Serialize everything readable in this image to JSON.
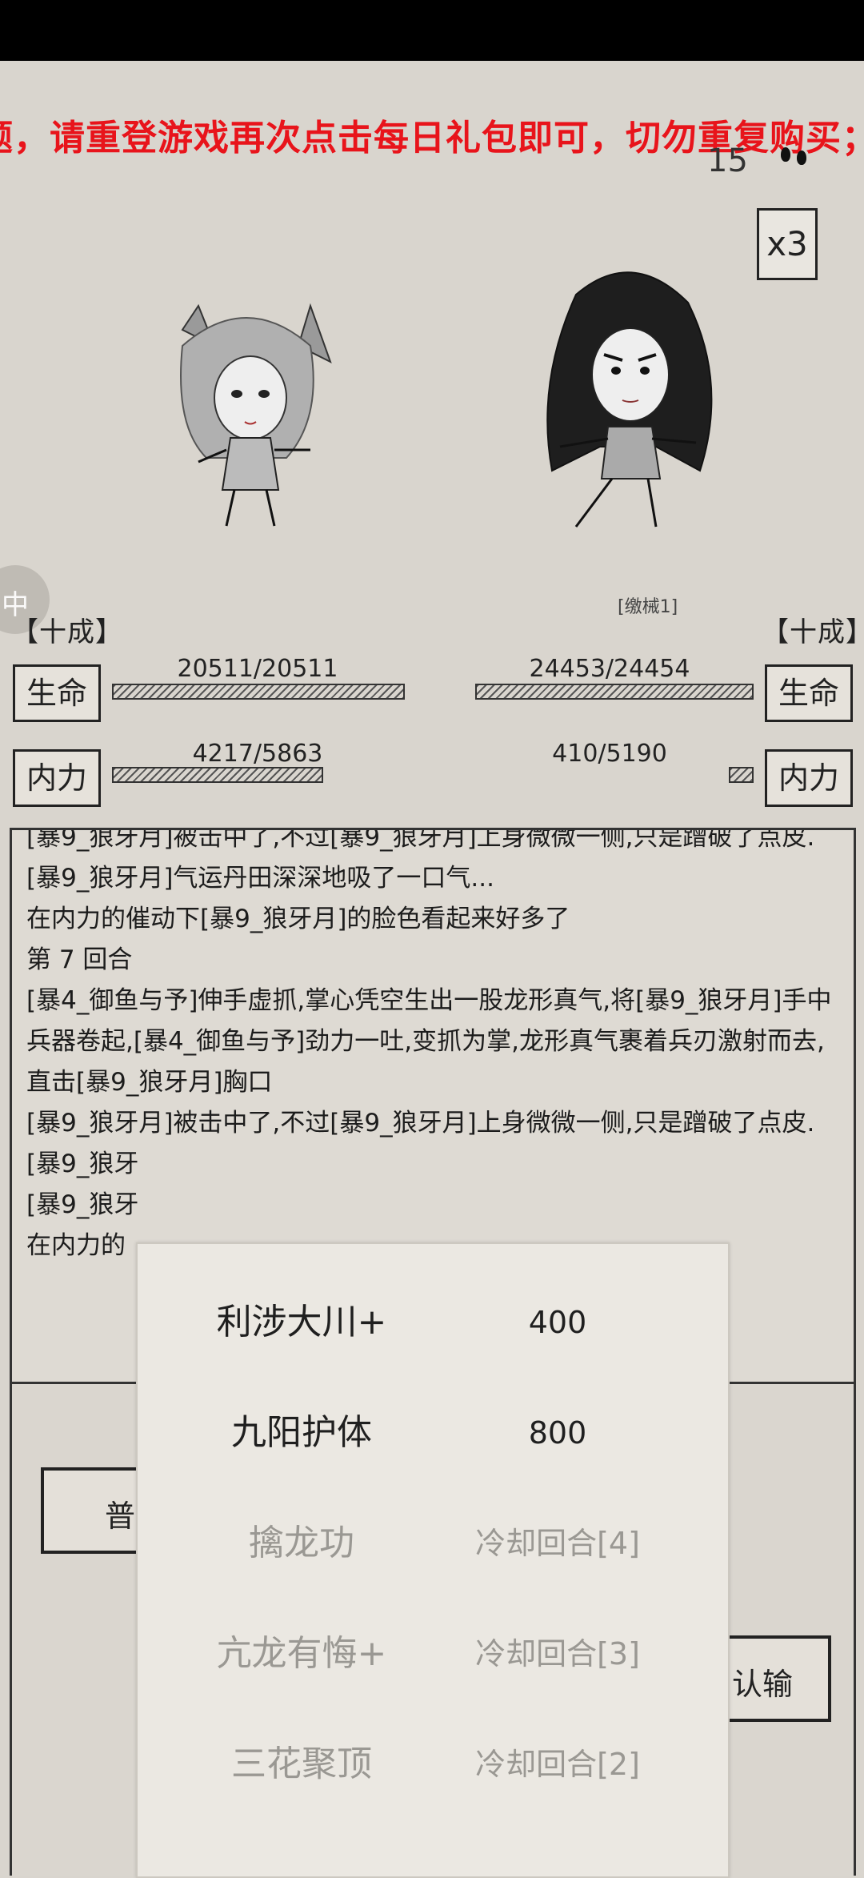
{
  "marquee_text": "题，请重登游戏再次点击每日礼包即可，切勿重复购买；",
  "turn_number": "15",
  "speed_button": "x3",
  "side_button_glyph": "中",
  "player": {
    "rank": "【十成】",
    "hp_label": "生命",
    "hp_text": "20511/20511",
    "hp_fraction": 1.0,
    "mp_label": "内力",
    "mp_text": "4217/5863",
    "mp_fraction": 0.719
  },
  "enemy": {
    "weapon_tag": "[缴械1]",
    "rank": "【十成】",
    "hp_label": "生命",
    "hp_text": "24453/24454",
    "hp_fraction": 1.0,
    "mp_label": "内力",
    "mp_text": "410/5190",
    "mp_fraction": 0.079
  },
  "battle_log": [
    "[暴9_狼牙月]被击中了,不过[暴9_狼牙月]上身微微一侧,只是蹭破了点皮.",
    "[暴9_狼牙月]气运丹田深深地吸了一口气...",
    "在内力的催动下[暴9_狼牙月]的脸色看起来好多了",
    "第 7 回合",
    "[暴4_御鱼与予]伸手虚抓,掌心凭空生出一股龙形真气,将[暴9_狼牙月]手中兵器卷起,[暴4_御鱼与予]劲力一吐,变抓为掌,龙形真气裹着兵刃激射而去,直击[暴9_狼牙月]胸口",
    "[暴9_狼牙月]被击中了,不过[暴9_狼牙月]上身微微一侧,只是蹭破了点皮.",
    "[暴9_狼牙",
    "[暴9_狼牙",
    "在内力的"
  ],
  "bottom_buttons": {
    "attack_partial": "普攻",
    "surrender_partial": "认输"
  },
  "skills": [
    {
      "name": "利涉大川+",
      "value": "400",
      "state": "enabled"
    },
    {
      "name": "九阳护体",
      "value": "800",
      "state": "enabled"
    },
    {
      "name": "擒龙功",
      "value": "冷却回合[4]",
      "state": "disabled"
    },
    {
      "name": "亢龙有悔+",
      "value": "冷却回合[3]",
      "state": "disabled"
    },
    {
      "name": "三花聚顶",
      "value": "冷却回合[2]",
      "state": "disabled"
    }
  ]
}
